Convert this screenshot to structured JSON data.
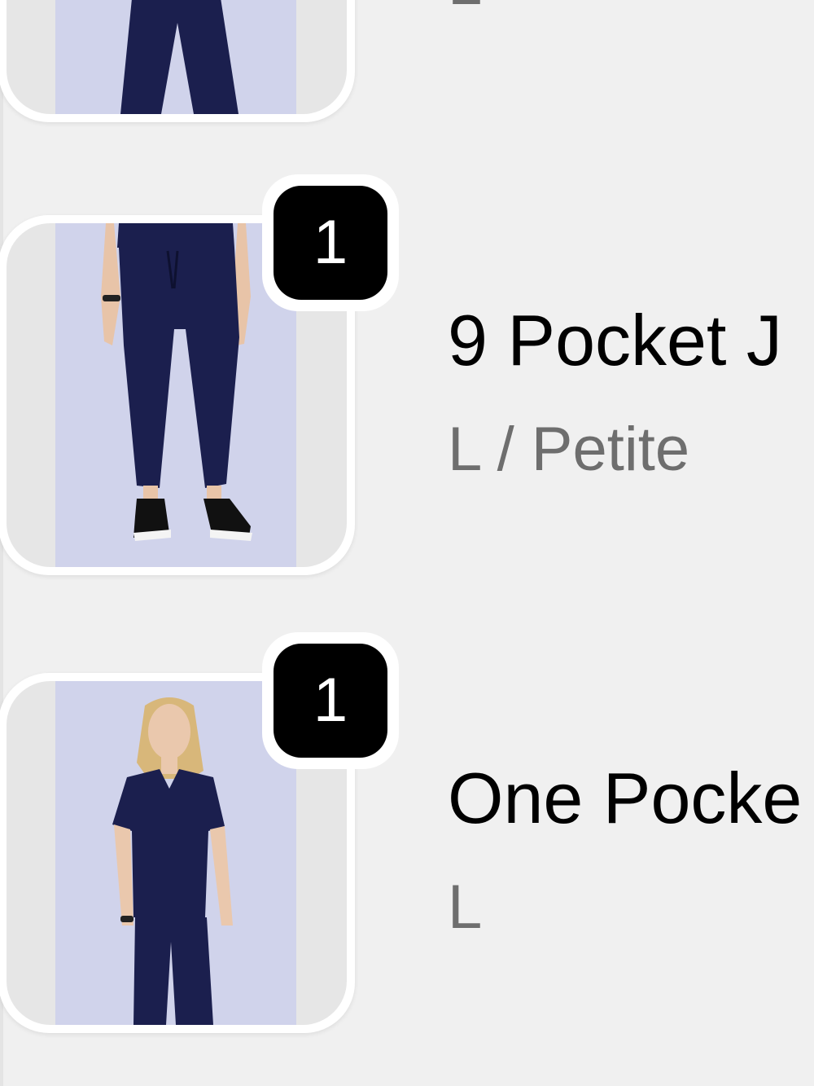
{
  "colors": {
    "background": "#f0f0f0",
    "badge_background": "#000000",
    "badge_text": "#ffffff",
    "name_text": "#000000",
    "variant_text": "#6e6e6e",
    "photo_backdrop": "#d0d3eb",
    "garment_navy": "#1b1f4e"
  },
  "cart": {
    "items": [
      {
        "name": "",
        "variant": "L",
        "quantity": "",
        "image_icon": "navy-scrub-pants-image"
      },
      {
        "name": "9 Pocket J",
        "variant": "L / Petite",
        "quantity": "1",
        "image_icon": "navy-jogger-pants-image"
      },
      {
        "name": "One Pocke",
        "variant": "L",
        "quantity": "1",
        "image_icon": "navy-scrub-top-image"
      }
    ]
  }
}
